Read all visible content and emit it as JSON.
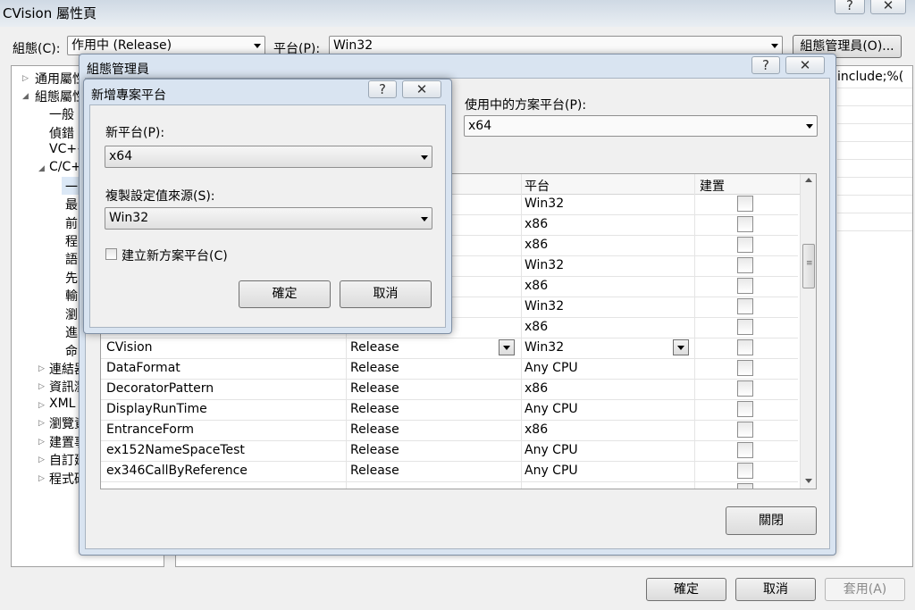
{
  "main": {
    "title": "CVision 屬性頁",
    "config_label": "組態(C):",
    "config_value": "作用中 (Release)",
    "platform_label": "平台(P):",
    "platform_value": "Win32",
    "config_manager_button": "組態管理員(O)...",
    "right_partial_text": "include;%(",
    "ok": "確定",
    "cancel": "取消",
    "apply": "套用(A)"
  },
  "tree": {
    "common": "通用屬性",
    "config_props": "組態屬性",
    "general": "一般",
    "debug": "偵錯",
    "vcpp": "VC++",
    "cc": "C/C++",
    "cc_children": [
      "一",
      "最",
      "前",
      "程",
      "語",
      "先",
      "輸",
      "瀏",
      "進",
      "命"
    ],
    "linker": "連結器",
    "info": "資訊瀏",
    "xml": "XML",
    "browse": "瀏覽資",
    "build": "建置事",
    "custom": "自訂建",
    "code": "程式碼"
  },
  "manager": {
    "title": "組態管理員",
    "active_platform_label": "使用中的方案平台(P):",
    "active_platform_value": "x64",
    "col_platform": "平台",
    "col_build": "建置",
    "close": "關閉",
    "rows": [
      {
        "project": "",
        "config": "",
        "platform": "Win32"
      },
      {
        "project": "",
        "config": "",
        "platform": "x86"
      },
      {
        "project": "",
        "config": "",
        "platform": "x86"
      },
      {
        "project": "",
        "config": "",
        "platform": "Win32"
      },
      {
        "project": "",
        "config": "",
        "platform": "x86"
      },
      {
        "project": "",
        "config": "",
        "platform": "Win32"
      },
      {
        "project": "",
        "config": "",
        "platform": "x86"
      },
      {
        "project": "CVision",
        "config": "Release",
        "platform": "Win32"
      },
      {
        "project": "DataFormat",
        "config": "Release",
        "platform": "Any CPU"
      },
      {
        "project": "DecoratorPattern",
        "config": "Release",
        "platform": "x86"
      },
      {
        "project": "DisplayRunTime",
        "config": "Release",
        "platform": "Any CPU"
      },
      {
        "project": "EntranceForm",
        "config": "Release",
        "platform": "x86"
      },
      {
        "project": "ex152NameSpaceTest",
        "config": "Release",
        "platform": "Any CPU"
      },
      {
        "project": "ex346CallByReference",
        "config": "Release",
        "platform": "Any CPU"
      }
    ]
  },
  "new_platform": {
    "title": "新增專案平台",
    "new_platform_label": "新平台(P):",
    "new_platform_value": "x64",
    "copy_from_label": "複製設定值來源(S):",
    "copy_from_value": "Win32",
    "create_solution_label": "建立新方案平台(C)",
    "create_solution_checked": false,
    "ok": "確定",
    "cancel": "取消"
  }
}
